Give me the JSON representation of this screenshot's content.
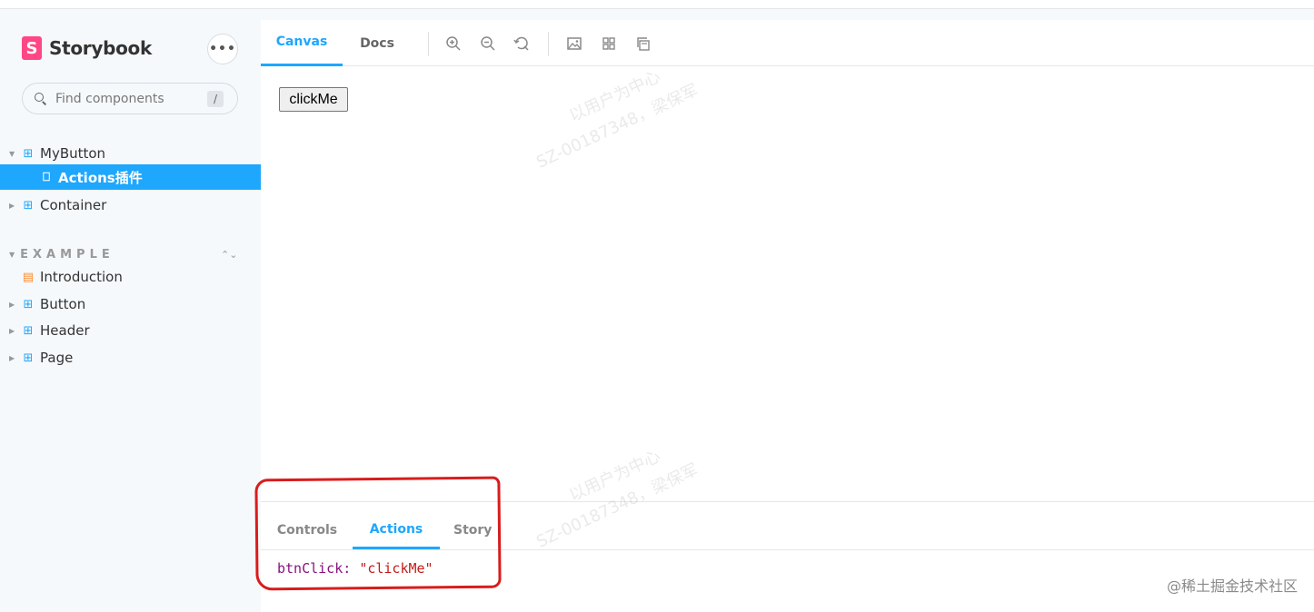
{
  "brand": {
    "name": "Storybook",
    "logo_letter": "S",
    "menu_label": "•••"
  },
  "search": {
    "placeholder": "Find components",
    "shortcut": "/"
  },
  "tree": {
    "groups": [
      {
        "label": "MyButton"
      },
      {
        "label": "Actions插件"
      },
      {
        "label": "Container"
      }
    ],
    "section_title": "EXAMPLE",
    "section_toggle": "⌃⌄",
    "example_items": [
      {
        "label": "Introduction"
      },
      {
        "label": "Button"
      },
      {
        "label": "Header"
      },
      {
        "label": "Page"
      }
    ]
  },
  "toolbar": {
    "tabs": [
      {
        "label": "Canvas"
      },
      {
        "label": "Docs"
      }
    ],
    "icons": [
      "zoom-in-icon",
      "zoom-out-icon",
      "zoom-reset-icon",
      "image-icon",
      "grid-icon",
      "outline-icon"
    ]
  },
  "canvas": {
    "button_label": "clickMe"
  },
  "addons": {
    "tabs": [
      {
        "label": "Controls"
      },
      {
        "label": "Actions"
      },
      {
        "label": "Story"
      }
    ],
    "log_key": "btnClick:",
    "log_value": "\"clickMe\""
  },
  "watermark": {
    "line1": "以用户为中心",
    "line2": "SZ-00187348，梁保军"
  },
  "footer": {
    "text": "@稀土掘金技术社区"
  },
  "colors": {
    "accent": "#1ea7fd",
    "brand": "#ff4785",
    "annotation": "#d91c1c"
  }
}
